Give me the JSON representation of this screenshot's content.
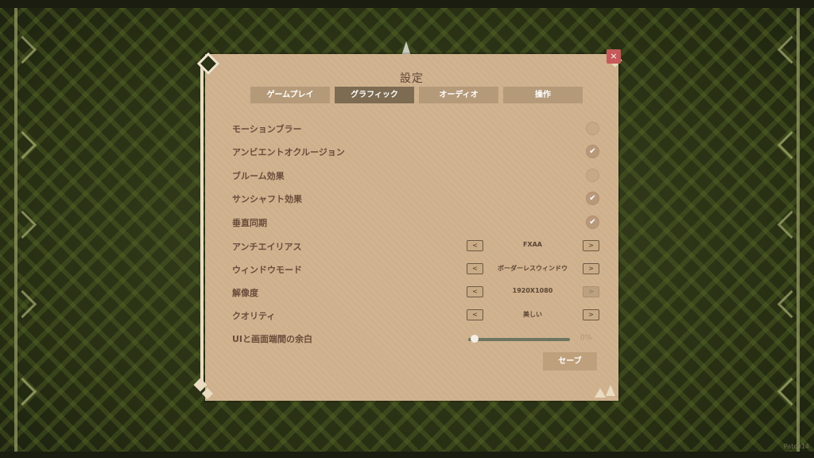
{
  "dialog": {
    "title": "設定",
    "close_label": "×",
    "save_label": "セーブ"
  },
  "tabs": [
    {
      "label": "ゲームプレイ",
      "active": false
    },
    {
      "label": "グラフィック",
      "active": true
    },
    {
      "label": "オーディオ",
      "active": false
    },
    {
      "label": "操作",
      "active": false
    }
  ],
  "toggles": [
    {
      "label": "モーションブラー",
      "checked": false
    },
    {
      "label": "アンビエントオクルージョン",
      "checked": true
    },
    {
      "label": "ブルーム効果",
      "checked": false
    },
    {
      "label": "サンシャフト効果",
      "checked": true
    },
    {
      "label": "垂直同期",
      "checked": true
    }
  ],
  "selectors": [
    {
      "label": "アンチエイリアス",
      "value": "FXAA",
      "prev": "<",
      "next": ">"
    },
    {
      "label": "ウィンドウモード",
      "value": "ボーダーレスウィンドウ",
      "prev": "<",
      "next": ">"
    },
    {
      "label": "解像度",
      "value": "1920X1080",
      "prev": "<",
      "next": ">"
    },
    {
      "label": "クオリティ",
      "value": "美しい",
      "prev": "<",
      "next": ">"
    }
  ],
  "slider": {
    "label": "UIと画面端間の余白",
    "value_text": "0%",
    "value": 0
  },
  "footer": {
    "patch_text": "Patch14"
  },
  "icons": {
    "check": "✔"
  }
}
